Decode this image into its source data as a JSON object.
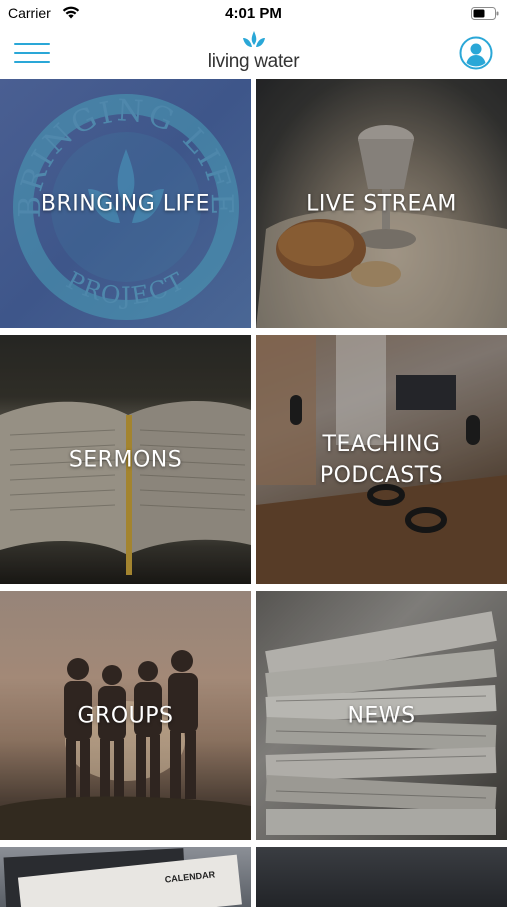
{
  "status_bar": {
    "carrier": "Carrier",
    "time": "4:01 PM"
  },
  "header": {
    "logo_text": "living water",
    "menu_icon": "hamburger-menu-icon",
    "profile_icon": "user-profile-icon",
    "accent_color": "#2aa7d7"
  },
  "tiles": [
    {
      "label": "BRINGING LIFE",
      "seal_top": "BRINGING LIFE",
      "seal_bottom": "PROJECT"
    },
    {
      "label": "LIVE STREAM"
    },
    {
      "label": "SERMONS"
    },
    {
      "label": "TEACHING\nPODCASTS"
    },
    {
      "label": "GROUPS"
    },
    {
      "label": "NEWS"
    },
    {
      "label": "",
      "partial_text": "CALENDAR"
    },
    {
      "label": ""
    }
  ]
}
